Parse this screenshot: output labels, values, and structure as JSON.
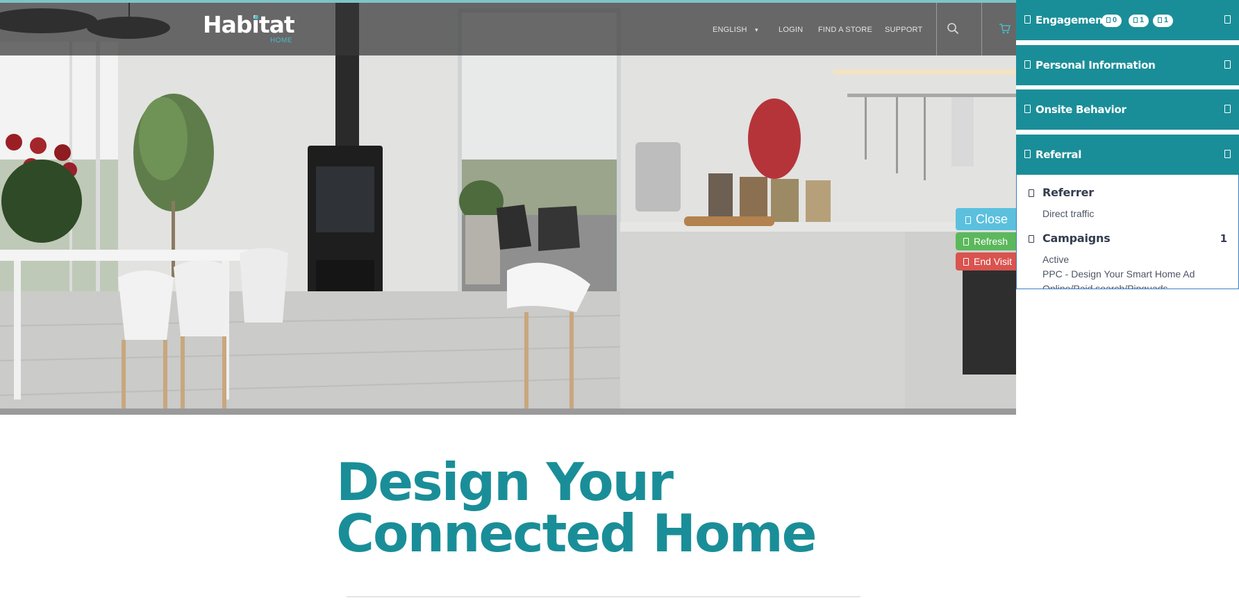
{
  "header": {
    "logo": {
      "brand": "Habitat",
      "sub": "HOME"
    },
    "nav": [
      {
        "label": "ENGLISH",
        "caret": "chevron-down-icon"
      },
      {
        "label": "LOGIN"
      },
      {
        "label": "FIND A STORE"
      },
      {
        "label": "SUPPORT"
      }
    ],
    "icons": [
      "search-icon",
      "cart-icon"
    ]
  },
  "hero": {
    "description": "kitchen and dining room scene"
  },
  "side_buttons": {
    "close": "Close",
    "refresh": "Refresh",
    "end_visit": "End Visit"
  },
  "panel": {
    "sections": [
      {
        "title": "Engagement",
        "badges": [
          "0",
          "1",
          "1"
        ]
      },
      {
        "title": "Personal Information"
      },
      {
        "title": "Onsite Behavior"
      },
      {
        "title": "Referral"
      }
    ],
    "referral": {
      "referrer": {
        "label": "Referrer",
        "value": "Direct traffic"
      },
      "campaigns": {
        "label": "Campaigns",
        "count": "1",
        "status": "Active",
        "name": "PPC - Design Your Smart Home Ad",
        "channel": "Online/Paid search/Pinguads"
      }
    }
  },
  "content": {
    "headline_line1": "Design Your",
    "headline_line2": "Connected Home"
  },
  "colors": {
    "accent": "#1a8e98",
    "close": "#5bc0de",
    "refresh": "#5cb85c",
    "end_visit": "#d9534f",
    "header_bg": "#373737"
  }
}
